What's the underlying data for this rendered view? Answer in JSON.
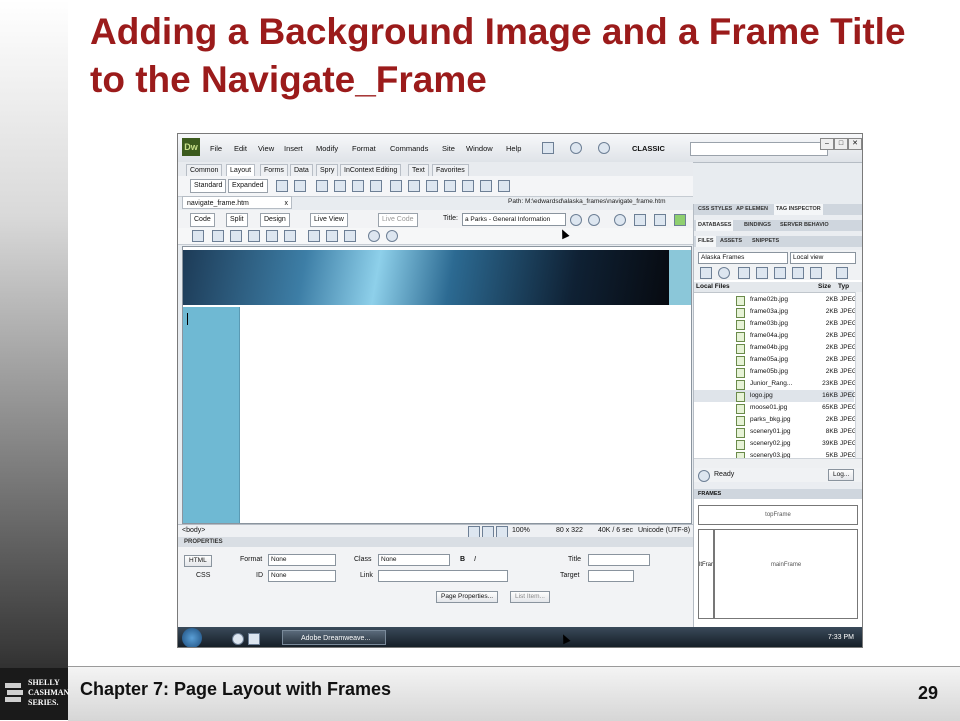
{
  "slide": {
    "title": "Adding a Background Image and a Frame Title to the Navigate_Frame",
    "footer": "Chapter 7: Page Layout with Frames",
    "page_number": "29",
    "logo_lines": [
      "SHELLY",
      "CASHMAN",
      "SERIES."
    ],
    "title_color": "#9b1b1b"
  },
  "app": {
    "logo": "Dw",
    "menus": [
      "File",
      "Edit",
      "View",
      "Insert",
      "Modify",
      "Format",
      "Commands",
      "Site",
      "Window",
      "Help"
    ],
    "workspace": "CLASSIC",
    "window_controls": [
      "–",
      "□",
      "✕"
    ]
  },
  "insert_tabs": [
    "Common",
    "Layout",
    "Forms",
    "Data",
    "Spry",
    "InContext Editing",
    "Text",
    "Favorites"
  ],
  "view_toggle": [
    "Standard",
    "Expanded"
  ],
  "document": {
    "tab": "navigate_frame.htm",
    "tab_close": "x",
    "path": "Path: M:\\edwardsd\\alaska_frames\\navigate_frame.htm",
    "view_buttons": [
      "Code",
      "Split",
      "Design"
    ],
    "live_view": "Live View",
    "live_code": "Live Code",
    "title_label": "Title:",
    "title_value": "a Parks - General Information"
  },
  "status_bar": {
    "tag": "<body>",
    "zoom": "100%",
    "size": "80 x 322",
    "weight": "40K / 6 sec",
    "encoding": "Unicode (UTF-8)"
  },
  "properties": {
    "header": "PROPERTIES",
    "html_btn": "HTML",
    "css_btn": "CSS",
    "format_label": "Format",
    "format_value": "None",
    "class_label": "Class",
    "class_value": "None",
    "bold": "B",
    "italic": "I",
    "title_label": "Title",
    "id_label": "ID",
    "id_value": "None",
    "link_label": "Link",
    "target_label": "Target",
    "page_props": "Page Properties...",
    "list_item": "List Item..."
  },
  "panels": {
    "top_tabs": [
      "CSS STYLES",
      "AP ELEMEN",
      "TAG INSPECTOR"
    ],
    "mid_tabs": [
      "DATABASES",
      "BINDINGS",
      "SERVER BEHAVIO"
    ],
    "files_tabs": [
      "FILES",
      "ASSETS",
      "SNIPPETS"
    ],
    "site": "Alaska Frames",
    "view": "Local view",
    "columns": [
      "Local Files",
      "Size",
      "Typ"
    ],
    "files": [
      {
        "name": "frame02b.jpg",
        "size": "2KB",
        "type": "JPEG"
      },
      {
        "name": "frame03a.jpg",
        "size": "2KB",
        "type": "JPEG"
      },
      {
        "name": "frame03b.jpg",
        "size": "2KB",
        "type": "JPEG"
      },
      {
        "name": "frame04a.jpg",
        "size": "2KB",
        "type": "JPEG"
      },
      {
        "name": "frame04b.jpg",
        "size": "2KB",
        "type": "JPEG"
      },
      {
        "name": "frame05a.jpg",
        "size": "2KB",
        "type": "JPEG"
      },
      {
        "name": "frame05b.jpg",
        "size": "2KB",
        "type": "JPEG"
      },
      {
        "name": "Junior_Rang...",
        "size": "23KB",
        "type": "JPEG"
      },
      {
        "name": "logo.jpg",
        "size": "16KB",
        "type": "JPEG"
      },
      {
        "name": "moose01.jpg",
        "size": "65KB",
        "type": "JPEG"
      },
      {
        "name": "parks_bkg.jpg",
        "size": "2KB",
        "type": "JPEG"
      },
      {
        "name": "scenery01.jpg",
        "size": "8KB",
        "type": "JPEG"
      },
      {
        "name": "scenery02.jpg",
        "size": "39KB",
        "type": "JPEG"
      },
      {
        "name": "scenery03.jpg",
        "size": "5KB",
        "type": "JPEG"
      }
    ],
    "ready": "Ready",
    "log_btn": "Log...",
    "frames_header": "FRAMES",
    "frame_top": "topFrame",
    "frame_left": "ltFrar",
    "frame_main": "mainFrame"
  },
  "taskbar": {
    "app": "Adobe Dreamweave...",
    "time": "7:33 PM"
  }
}
